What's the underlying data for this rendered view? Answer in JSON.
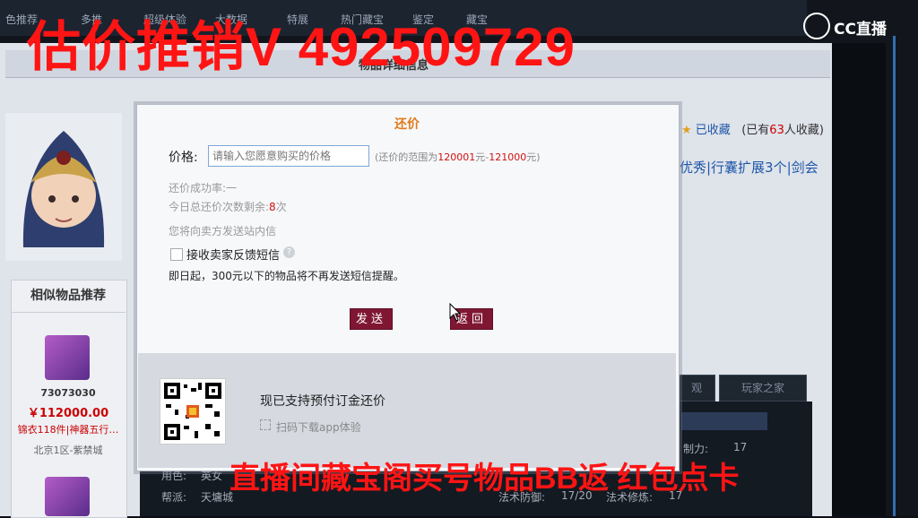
{
  "watermark": {
    "top": "估价推销V 492509729",
    "bottom": "直播间藏宝阁买号物品BB返 红包点卡"
  },
  "logo": {
    "text": "CC直播"
  },
  "background_page": {
    "top_tabs": [
      "色推荐",
      "多推",
      "超级体验",
      "大数据",
      "特展",
      "热门藏宝",
      "鉴定",
      "藏宝"
    ],
    "header_title": "物品详细信息",
    "favorite": {
      "label": "已收藏",
      "count_prefix": "(已有",
      "count": "63",
      "count_suffix": "人收藏)"
    },
    "char_tags": "优秀|行囊扩展3个|剑会",
    "recommend": {
      "title": "相似物品推荐",
      "item_id": "73073030",
      "price": "￥112000.00",
      "desc": "锦衣118件|神器五行…",
      "server": "北京1区-紫禁城"
    },
    "tabs": [
      "观",
      "玩家之家"
    ],
    "stats": [
      {
        "label": "制力:",
        "value": "17"
      },
      {
        "label": "用色:",
        "value": "英女"
      },
      {
        "label": "帮派:",
        "value": "天墉城"
      },
      {
        "label": "法术防御:",
        "value": "17/20"
      },
      {
        "label": "法术修炼:",
        "value": "17"
      }
    ]
  },
  "modal": {
    "title": "还价",
    "price_label": "价格:",
    "price_placeholder": "请输入您愿意购买的价格",
    "range_prefix": "(还价的范围为",
    "range_min": "120001",
    "range_mid": "元-",
    "range_max": "121000",
    "range_suffix": "元)",
    "success_rate": "还价成功率:一",
    "remaining_prefix": "今日总还价次数剩余:",
    "remaining_count": "8",
    "remaining_suffix": "次",
    "notify_text": "您将向卖方发送站内信",
    "sms_checkbox_label": "接收卖家反馈短信",
    "sms_note": "即日起，300元以下的物品将不再发送短信提醒。",
    "send_button": "发送",
    "back_button": "返回",
    "footer_title": "现已支持预付订金还价",
    "footer_sub": "扫码下载app体验"
  },
  "colors": {
    "watermark": "#ff1414",
    "modal_title": "#e07a1a",
    "button_bg": "#7f1733",
    "range_highlight": "#d01010"
  }
}
